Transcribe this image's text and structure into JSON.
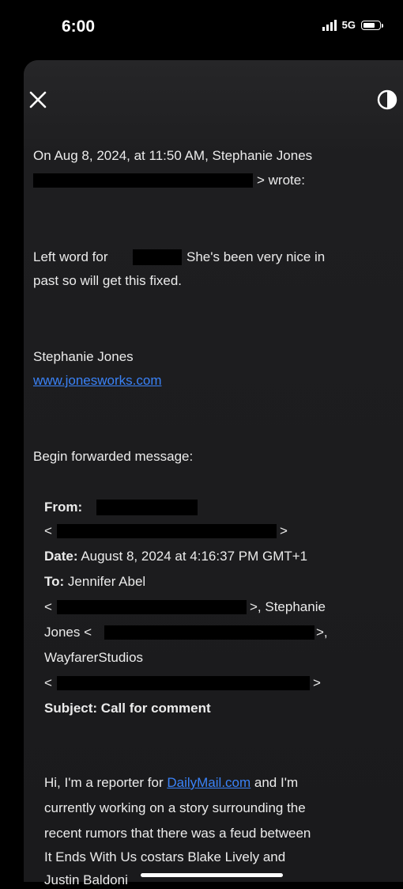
{
  "status": {
    "time": "6:00",
    "network": "5G"
  },
  "header": {
    "close_icon": "close-icon",
    "contrast_icon": "contrast-icon"
  },
  "email": {
    "intro_line1": "On Aug 8, 2024, at 11:50 AM, Stephanie Jones",
    "intro_line2_suffix": "> wrote:",
    "body_line1_a": "Left word for",
    "body_line1_b": "She's been very nice in",
    "body_line2": "past so will get this fixed.",
    "signature_name": "Stephanie Jones",
    "signature_link": "www.jonesworks.com",
    "forward_label": "Begin forwarded message:",
    "from_label": "From:",
    "lt": "<",
    "gt": ">",
    "date_label": "Date:",
    "date_value": "August 8, 2024 at 4:16:37 PM GMT+1",
    "to_label": "To:",
    "to_name": "Jennifer Abel",
    "to_line2_suffix": ">, Stephanie",
    "to_line3_prefix": "Jones <",
    "to_line3_suffix": ">,",
    "to_line4": "WayfarerStudios",
    "subject_label": "Subject:",
    "subject_value": "Call for comment",
    "p1_a": "Hi, I'm a reporter for",
    "p1_link": "DailyMail.com",
    "p1_b": "and I'm",
    "p2": "currently working on a story surrounding the",
    "p3": "recent rumors that there was a feud between",
    "p4": "It Ends With Us costars Blake Lively and",
    "p5": "Justin Baldoni"
  }
}
